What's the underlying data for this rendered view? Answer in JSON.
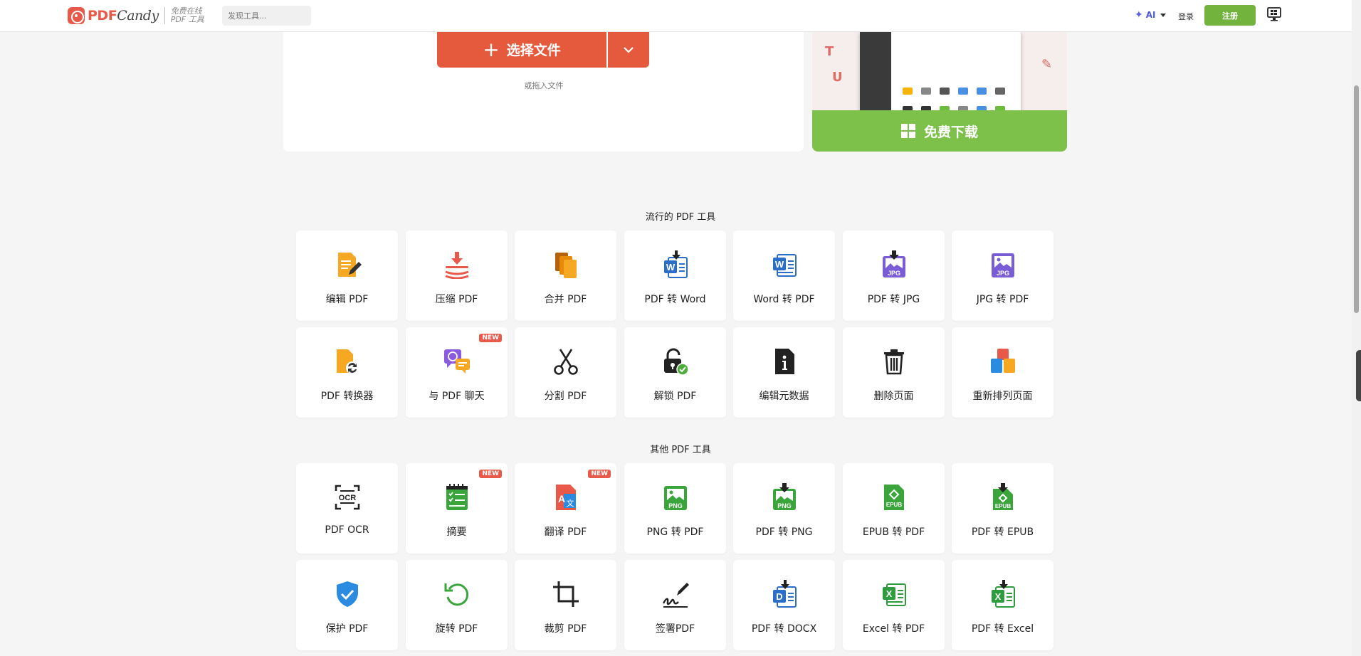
{
  "header": {
    "logo_pdf": "PDF",
    "logo_candy": "Candy",
    "logo_sub_1": "免费在线",
    "logo_sub_2": "PDF 工具",
    "search_placeholder": "发现工具...",
    "ai_label": "AI",
    "login_label": "登录",
    "register_label": "注册"
  },
  "upload": {
    "choose_label": "选择文件",
    "drag_label": "或拖入文件"
  },
  "promo": {
    "download_label": "免费下载"
  },
  "popular": {
    "title": "流行的 PDF 工具",
    "tools": [
      {
        "label": "编辑 PDF",
        "icon": "edit-pdf-icon"
      },
      {
        "label": "压缩 PDF",
        "icon": "compress-icon"
      },
      {
        "label": "合并 PDF",
        "icon": "merge-icon"
      },
      {
        "label": "PDF 转 Word",
        "icon": "pdf-to-word-icon"
      },
      {
        "label": "Word 转 PDF",
        "icon": "word-to-pdf-icon"
      },
      {
        "label": "PDF 转 JPG",
        "icon": "pdf-to-jpg-icon"
      },
      {
        "label": "JPG 转 PDF",
        "icon": "jpg-to-pdf-icon"
      },
      {
        "label": "PDF 转换器",
        "icon": "converter-icon"
      },
      {
        "label": "与 PDF 聊天",
        "icon": "chat-icon",
        "badge": "NEW"
      },
      {
        "label": "分割 PDF",
        "icon": "scissors-icon"
      },
      {
        "label": "解锁 PDF",
        "icon": "unlock-icon"
      },
      {
        "label": "编辑元数据",
        "icon": "metadata-icon"
      },
      {
        "label": "删除页面",
        "icon": "trash-icon"
      },
      {
        "label": "重新排列页面",
        "icon": "rearrange-icon"
      }
    ]
  },
  "other": {
    "title": "其他 PDF 工具",
    "tools": [
      {
        "label": "PDF OCR",
        "icon": "ocr-icon"
      },
      {
        "label": "摘要",
        "icon": "summary-icon",
        "badge": "NEW"
      },
      {
        "label": "翻译 PDF",
        "icon": "translate-icon",
        "badge": "NEW"
      },
      {
        "label": "PNG 转 PDF",
        "icon": "png-to-pdf-icon"
      },
      {
        "label": "PDF 转 PNG",
        "icon": "pdf-to-png-icon"
      },
      {
        "label": "EPUB 转 PDF",
        "icon": "epub-to-pdf-icon"
      },
      {
        "label": "PDF 转 EPUB",
        "icon": "pdf-to-epub-icon"
      },
      {
        "label": "保护 PDF",
        "icon": "shield-icon"
      },
      {
        "label": "旋转 PDF",
        "icon": "rotate-icon"
      },
      {
        "label": "裁剪 PDF",
        "icon": "crop-icon"
      },
      {
        "label": "签署PDF",
        "icon": "sign-icon"
      },
      {
        "label": "PDF 转 DOCX",
        "icon": "pdf-to-docx-icon"
      },
      {
        "label": "Excel 转 PDF",
        "icon": "excel-to-pdf-icon"
      },
      {
        "label": "PDF 转 Excel",
        "icon": "pdf-to-excel-icon"
      }
    ]
  }
}
